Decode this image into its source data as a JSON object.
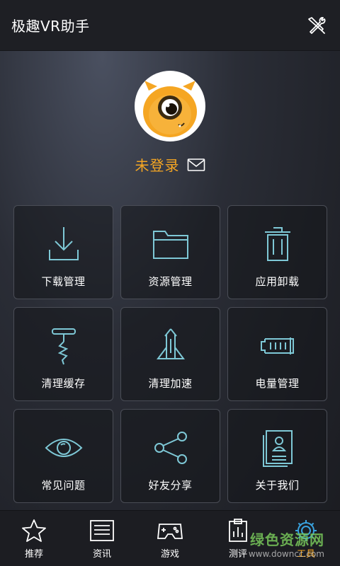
{
  "header": {
    "title": "极趣VR助手",
    "tools_icon": "wrench-screwdriver-icon"
  },
  "profile": {
    "avatar_icon": "yellow-monster-avatar",
    "login_text": "未登录",
    "mail_icon": "envelope-icon",
    "accent_color": "#f5a623"
  },
  "tiles": [
    {
      "label": "下载管理",
      "icon": "download-icon"
    },
    {
      "label": "资源管理",
      "icon": "folder-icon"
    },
    {
      "label": "应用卸载",
      "icon": "trash-icon"
    },
    {
      "label": "清理缓存",
      "icon": "corkscrew-icon"
    },
    {
      "label": "清理加速",
      "icon": "rocket-icon"
    },
    {
      "label": "电量管理",
      "icon": "battery-icon"
    },
    {
      "label": "常见问题",
      "icon": "eye-icon"
    },
    {
      "label": "好友分享",
      "icon": "share-icon"
    },
    {
      "label": "关于我们",
      "icon": "id-card-icon"
    }
  ],
  "bottom_nav": [
    {
      "label": "推荐",
      "icon": "star-icon",
      "active": false
    },
    {
      "label": "资讯",
      "icon": "news-icon",
      "active": false
    },
    {
      "label": "游戏",
      "icon": "gamepad-icon",
      "active": false
    },
    {
      "label": "测评",
      "icon": "clipboard-icon",
      "active": false
    },
    {
      "label": "工具",
      "icon": "gear-icon",
      "active": true
    }
  ],
  "watermark": {
    "main": "绿色资源网",
    "sub": "www.downcc.com"
  }
}
